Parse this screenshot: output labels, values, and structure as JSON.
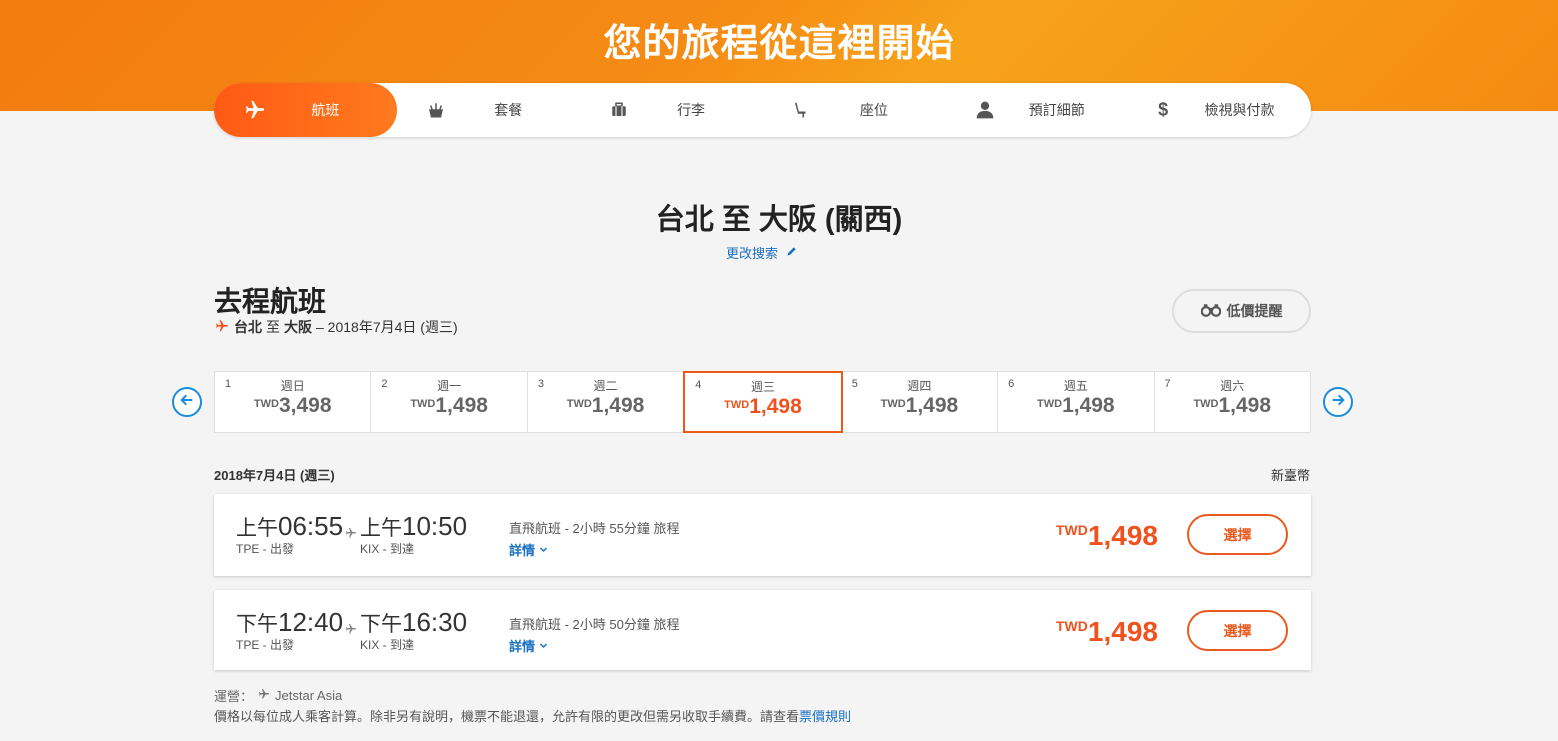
{
  "banner": {
    "title": "您的旅程從這裡開始"
  },
  "steps": [
    {
      "label": "航班",
      "icon": "plane-icon",
      "active": true
    },
    {
      "label": "套餐",
      "icon": "meal-icon"
    },
    {
      "label": "行李",
      "icon": "luggage-icon"
    },
    {
      "label": "座位",
      "icon": "seat-icon"
    },
    {
      "label": "預訂細節",
      "icon": "person-icon"
    },
    {
      "label": "檢視與付款",
      "icon": "dollar-icon"
    }
  ],
  "route": {
    "title": "台北 至 大阪 (關西)",
    "modify_label": "更改搜索"
  },
  "outbound": {
    "title": "去程航班",
    "origin": "台北",
    "to": "至",
    "destination": "大阪",
    "date": "– 2018年7月4日 (週三)"
  },
  "price_alert": {
    "label": "低價提醒"
  },
  "dates": [
    {
      "num": "1",
      "weekday": "週日",
      "currency": "TWD",
      "price": "3,498"
    },
    {
      "num": "2",
      "weekday": "週一",
      "currency": "TWD",
      "price": "1,498"
    },
    {
      "num": "3",
      "weekday": "週二",
      "currency": "TWD",
      "price": "1,498"
    },
    {
      "num": "4",
      "weekday": "週三",
      "currency": "TWD",
      "price": "1,498",
      "selected": true
    },
    {
      "num": "5",
      "weekday": "週四",
      "currency": "TWD",
      "price": "1,498"
    },
    {
      "num": "6",
      "weekday": "週五",
      "currency": "TWD",
      "price": "1,498"
    },
    {
      "num": "7",
      "weekday": "週六",
      "currency": "TWD",
      "price": "1,498"
    }
  ],
  "results": {
    "date_heading": "2018年7月4日 (週三)",
    "currency_note": "新臺幣"
  },
  "flights": [
    {
      "dep_ampm": "上午",
      "dep_time": "06:55",
      "dep_code": "TPE - 出發",
      "arr_ampm": "上午",
      "arr_time": "10:50",
      "arr_code": "KIX - 到達",
      "info": "直飛航班 - 2小時 55分鐘 旅程",
      "details": "詳情",
      "currency": "TWD",
      "price": "1,498",
      "select": "選擇"
    },
    {
      "dep_ampm": "下午",
      "dep_time": "12:40",
      "dep_code": "TPE - 出發",
      "arr_ampm": "下午",
      "arr_time": "16:30",
      "arr_code": "KIX - 到達",
      "info": "直飛航班 - 2小時 50分鐘 旅程",
      "details": "詳情",
      "currency": "TWD",
      "price": "1,498",
      "select": "選擇"
    }
  ],
  "footer": {
    "operated_label": "運營：",
    "operator": "Jetstar Asia",
    "note": "價格以每位成人乘客計算。除非另有說明，機票不能退還，允許有限的更改但需另收取手續費。請查看",
    "link": "票價規則"
  },
  "colors": {
    "accent": "#f0521e",
    "link": "#1a6fc2",
    "banner": "#f58c14"
  }
}
